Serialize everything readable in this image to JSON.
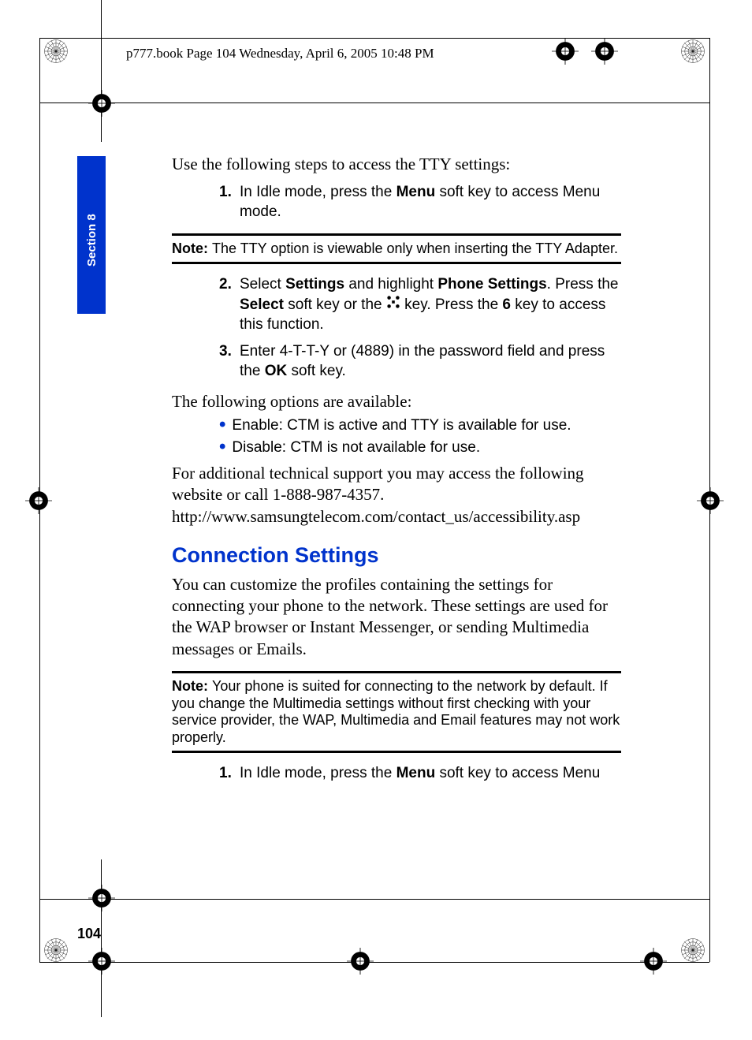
{
  "header": {
    "text": "p777.book  Page 104  Wednesday, April 6, 2005  10:48 PM"
  },
  "section_tab": "Section 8",
  "body": {
    "intro": "Use the following steps to access the TTY settings:",
    "step1_num": "1.",
    "step1_pre": "In Idle mode, press the ",
    "step1_b1": "Menu",
    "step1_post": " soft key to access Menu mode.",
    "note1_label": "Note: ",
    "note1_text": "The TTY option is  viewable only when inserting the TTY Adapter.",
    "step2_num": "2.",
    "step2_t1": "Select ",
    "step2_b1": "Settings",
    "step2_t2": " and highlight ",
    "step2_b2": "Phone Settings",
    "step2_t3": ". Press the ",
    "step2_b3": "Select",
    "step2_t4": " soft key or the ",
    "step2_t5": " key.  Press the ",
    "step2_b4": "6",
    "step2_t6": " key to access this function.",
    "step3_num": "3.",
    "step3_t1": "Enter 4-T-T-Y or (4889) in the password field and press the ",
    "step3_b1": "OK",
    "step3_t2": " soft key.",
    "options_intro": "The following options are available:",
    "bullet1": "Enable:  CTM is active and TTY is available for use.",
    "bullet2": "Disable: CTM is not available for use.",
    "support": "For additional technical support you may access the following website or call 1-888-987-4357.   http://www.samsungtelecom.com/contact_us/accessibility.asp",
    "heading": "Connection Settings",
    "connection_p": "You can customize the profiles containing the settings for connecting your phone to the network. These settings are used for the WAP browser or Instant Messenger, or sending Multimedia messages or Emails.",
    "note2_label": "Note: ",
    "note2_text": "Your phone is suited for connecting to the network by default. If you change the Multimedia settings without first checking with your service provider, the WAP, Multimedia and Email features may not work properly.",
    "step_c1_num": "1.",
    "step_c1_pre": "In Idle mode, press the ",
    "step_c1_b1": "Menu",
    "step_c1_post": " soft key to access Menu"
  },
  "page_number": "104"
}
